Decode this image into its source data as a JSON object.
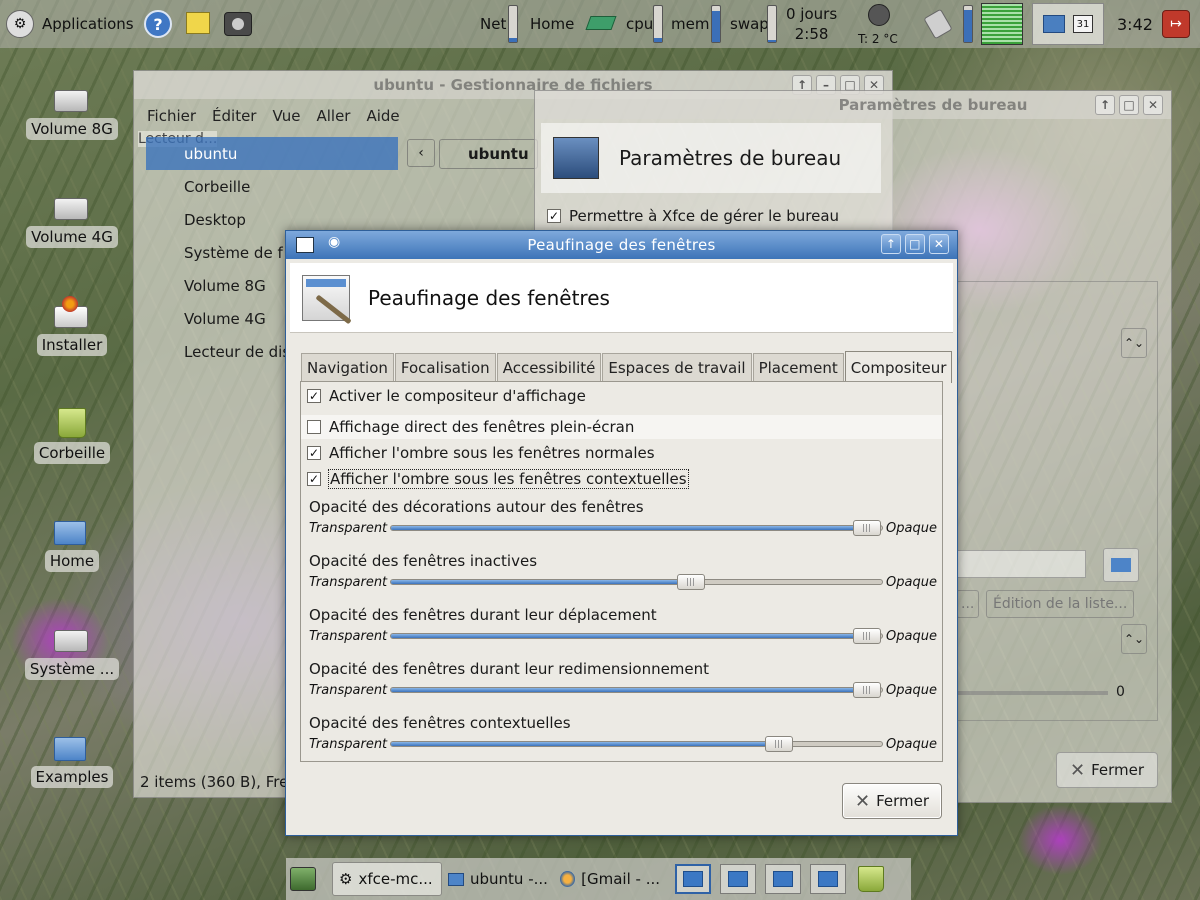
{
  "top_panel": {
    "applications": "Applications",
    "net": "Net",
    "home": "Home",
    "cpu": "cpu",
    "mem": "mem",
    "swap": "swap",
    "uptime_days": "0 jours",
    "uptime_time": "2:58",
    "temperature": "T: 2 °C",
    "calendar_day": "31",
    "clock": "3:42",
    "gauges": {
      "net": 0.1,
      "cpu": 0.1,
      "mem": 0.85,
      "swap": 0.05,
      "volume": 0.9
    }
  },
  "desktop_icons": [
    {
      "label": "Volume 8G",
      "icon": "drive-icon"
    },
    {
      "label": "Volume 4G",
      "icon": "drive-icon"
    },
    {
      "label": "Installer",
      "icon": "installer-icon"
    },
    {
      "label": "Corbeille",
      "icon": "trash-icon"
    },
    {
      "label": "Home",
      "icon": "home-folder-icon"
    },
    {
      "label": "Système ...",
      "icon": "drive-icon"
    },
    {
      "label": "Examples",
      "icon": "folder-icon"
    }
  ],
  "file_manager": {
    "title": "ubuntu - Gestionnaire de fichiers",
    "menu": [
      "Fichier",
      "Éditer",
      "Vue",
      "Aller",
      "Aide"
    ],
    "tooltip": "Lecteur d...",
    "sidebar": [
      "ubuntu",
      "Corbeille",
      "Desktop",
      "Système de f",
      "Volume 8G",
      "Volume 4G",
      "Lecteur de dis"
    ],
    "path_button": "ubuntu",
    "status": "2 items (360 B), Fre"
  },
  "desktop_settings": {
    "title": "Paramètres de bureau",
    "header": "Paramètres de bureau",
    "manage_checkbox": "Permettre à Xfce de gérer le bureau",
    "edit_list_button": "Édition de la liste...",
    "ellipsis_button": "...",
    "slider_value": "0",
    "close_button": "Fermer"
  },
  "dialog": {
    "title": "Peaufinage des fenêtres",
    "header": "Peaufinage des fenêtres",
    "tabs": [
      "Navigation",
      "Focalisation",
      "Accessibilité",
      "Espaces de travail",
      "Placement",
      "Compositeur"
    ],
    "active_tab": "Compositeur",
    "checkboxes": [
      {
        "label": "Activer le compositeur d'affichage",
        "checked": true
      },
      {
        "label": "Affichage direct des fenêtres plein-écran",
        "checked": false
      },
      {
        "label": "Afficher l'ombre sous les fenêtres normales",
        "checked": true
      },
      {
        "label": "Afficher l'ombre sous les fenêtres contextuelles",
        "checked": true
      }
    ],
    "slider_min_label": "Transparent",
    "slider_max_label": "Opaque",
    "sliders": [
      {
        "label": "Opacité des décorations autour des fenêtres",
        "value": 0.97
      },
      {
        "label": "Opacité des fenêtres inactives",
        "value": 0.61
      },
      {
        "label": "Opacité des fenêtres durant leur déplacement",
        "value": 0.97
      },
      {
        "label": "Opacité des fenêtres durant leur redimensionnement",
        "value": 0.97
      },
      {
        "label": "Opacité des fenêtres contextuelles",
        "value": 0.79
      }
    ],
    "close_button": "Fermer"
  },
  "taskbar": {
    "tasks": [
      "xfce-mc...",
      "ubuntu -...",
      "[Gmail - ..."
    ]
  },
  "colors": {
    "accent": "#3d74b8",
    "dialog_bg": "#eceae4",
    "selection": "#3b73bb"
  }
}
